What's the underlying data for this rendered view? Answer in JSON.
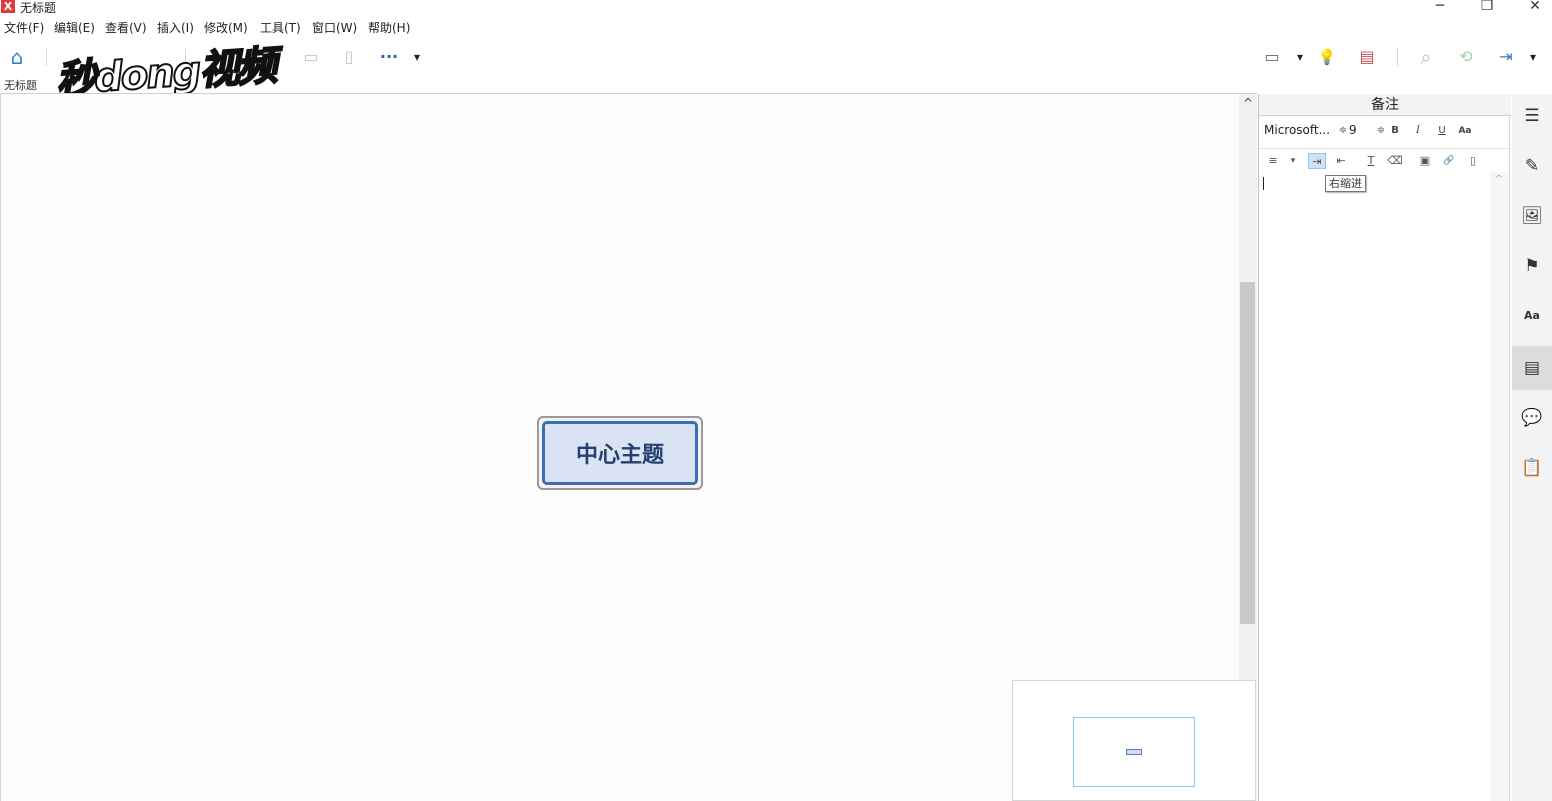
{
  "window": {
    "title": "无标题",
    "app_icon": "X",
    "controls": {
      "minimize": "─",
      "restore": "❐",
      "close": "✕"
    }
  },
  "menu": [
    "文件(F)",
    "编辑(E)",
    "查看(V)",
    "插入(I)",
    "修改(M)",
    "工具(T)",
    "窗口(W)",
    "帮助(H)"
  ],
  "toolbar": {
    "home_icon": "⌂",
    "more_icon": "···",
    "dropdown_icon": "▾",
    "presentation_icon": "▭",
    "idea_icon": "💡",
    "gantt_icon": "▤",
    "search_icon": "⌕",
    "share_icon": "⟲",
    "export_icon": "⇥"
  },
  "watermark": {
    "text": "秒dong视频"
  },
  "document_tab": "无标题",
  "canvas": {
    "central_topic": "中心主题"
  },
  "notes_panel": {
    "title": "备注",
    "font_name": "Microsoft...",
    "font_size": "9",
    "bold": "B",
    "italic": "I",
    "underline": "U",
    "case": "Aa",
    "spin": "≑",
    "align_icon": "≡",
    "align_dropdown": "▾",
    "indent_right_icon": "⇥",
    "indent_left_icon": "⇤",
    "clear_format_icon": "T",
    "eraser_icon": "⌫",
    "image_icon": "▣",
    "link_icon": "🔗",
    "attach_icon": "▯",
    "tooltip": "右缩进",
    "scroll_up": "^"
  },
  "right_sidebar": {
    "outline_icon": "☰",
    "style_icon": "✎",
    "image_icon": "🖼",
    "marker_icon": "⚑",
    "font_icon": "Aa",
    "notes_icon": "▤",
    "comment_icon": "💬",
    "task_icon": "📋"
  },
  "scrollbar": {
    "up": "^"
  }
}
